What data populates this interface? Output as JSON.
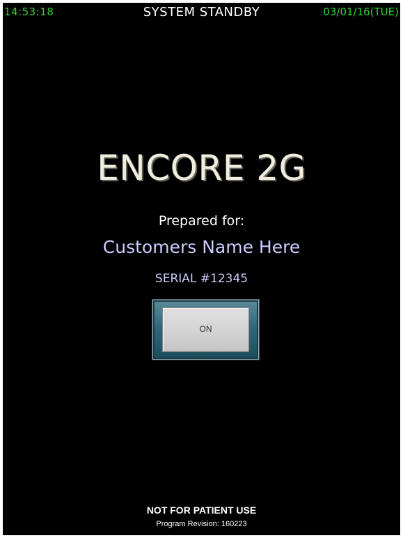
{
  "status_bar": {
    "time": "14:53:18",
    "system_status": "SYSTEM STANDBY",
    "date": "03/01/16(TUE)"
  },
  "main": {
    "device_title": "ENCORE 2G",
    "prepared_for_label": "Prepared for:",
    "customer_name": "Customers Name Here",
    "serial": "SERIAL #12345",
    "on_button_label": "ON"
  },
  "footer": {
    "warning": "NOT FOR PATIENT USE",
    "revision": "Program Revision: 160223"
  },
  "colors": {
    "background": "#000000",
    "status_green": "#2fd52f",
    "title": "#f1eee0",
    "customer_text": "#ccccff",
    "button_frame": "#2f6576",
    "button_face": "#d2d2d2"
  }
}
